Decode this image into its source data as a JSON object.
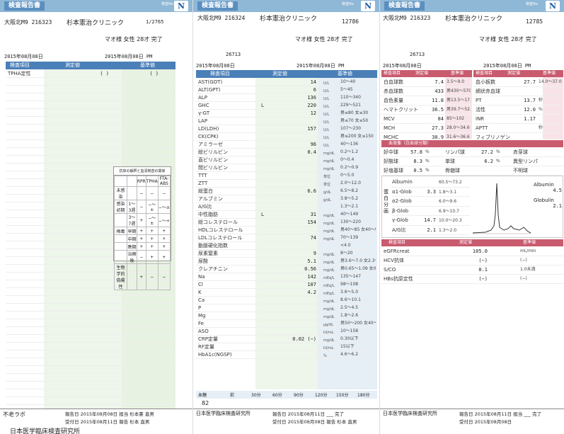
{
  "sheet1": {
    "title": "検査報告書",
    "header_small": "検査No",
    "patient_id": "大阪北M9 216323",
    "clinic": "杉本憲治クリニック",
    "page_no": "1/2765",
    "patient_line": "マオ様 女性 28才 完了",
    "received_label": "受付日",
    "received_date": "2015年08月08日",
    "reported_date": "2015年08月08日 PM",
    "col_item": "検査項目",
    "col_value": "測定値",
    "col_ref": "基準値",
    "rows": [
      {
        "name": "TPHA定性",
        "value": "( )",
        "ref": "( )"
      }
    ],
    "grid": {
      "title": "抗体の解釈と血清検査の関係",
      "head": [
        "",
        "",
        "RPR",
        "TPHA",
        "FTA-ABS"
      ],
      "rows": [
        [
          "未感染",
          "",
          "−",
          "−",
          "−"
        ],
        [
          "感染初期",
          "1〜3週",
          "−",
          "−〜±",
          "−〜±"
        ],
        [
          "",
          "3〜7週",
          "+",
          "−〜±",
          "−〜+"
        ],
        [
          "梅毒",
          "早期",
          "+",
          "+",
          "+"
        ],
        [
          "",
          "中期",
          "+",
          "+",
          "+"
        ],
        [
          "",
          "晩期",
          "+",
          "+",
          "+"
        ],
        [
          "",
          "治療後",
          "−",
          "+",
          "+"
        ],
        [
          "生物学的偽陽性",
          "",
          "+",
          "−",
          "−"
        ]
      ]
    },
    "footer_lab": "不老ラボ",
    "footer_dates": "報告日 2015年08月08日 担当 杉本憲 直男",
    "footer_dates2": "受付日 2015年08月11日 報告 杉本 直男",
    "footer_org": "日本医学臨床検査研究所"
  },
  "sheet2": {
    "title": "検査報告書",
    "header_small": "検査No",
    "patient_id": "大阪北M9 216324",
    "clinic": "杉本憲治クリニック",
    "page_no": "12786",
    "patient_line": "マオ様 女性 28才 完了",
    "doc_no": "26713",
    "received_date": "2015年08月08日",
    "reported_date": "2015年08月08日 PM",
    "col_item": "検査項目",
    "col_value": "測定値",
    "col_ref": "基準値",
    "rows": [
      {
        "name": "AST(GOT)",
        "flag": "",
        "value": "14",
        "unit": "U/L",
        "ref": "10〜40"
      },
      {
        "name": "ALT(GPT)",
        "flag": "",
        "value": "6",
        "unit": "U/L",
        "ref": "5〜45"
      },
      {
        "name": "ALP",
        "flag": "",
        "value": "136",
        "unit": "U/L",
        "ref": "110〜340"
      },
      {
        "name": "GHC",
        "flag": "L",
        "value": "220",
        "unit": "U/L",
        "ref": "229〜521"
      },
      {
        "name": "γ-GT",
        "flag": "",
        "value": "12",
        "unit": "U/L",
        "ref": "男≤80 女≤30"
      },
      {
        "name": "LAP",
        "flag": "",
        "value": "",
        "unit": "U/L",
        "ref": "男≤70 女≤50"
      },
      {
        "name": "LD(LDH)",
        "flag": "",
        "value": "157",
        "unit": "U/L",
        "ref": "107〜230"
      },
      {
        "name": "CK(CPK)",
        "flag": "",
        "value": "",
        "unit": "U/L",
        "ref": "男≤200 女≤150"
      },
      {
        "name": "アミラーゼ",
        "flag": "",
        "value": "96",
        "unit": "U/L",
        "ref": "40〜136"
      },
      {
        "name": "総ビリルビン",
        "flag": "",
        "value": "0.4",
        "unit": "mg/dL",
        "ref": "0.2〜1.2"
      },
      {
        "name": "直ビリルビン",
        "flag": "",
        "value": "",
        "unit": "mg/dL",
        "ref": "0〜0.4"
      },
      {
        "name": "間ビリルビン",
        "flag": "",
        "value": "",
        "unit": "mg/dL",
        "ref": "0.2〜0.9"
      },
      {
        "name": "TTT",
        "flag": "",
        "value": "",
        "unit": "単位",
        "ref": "0〜5.0"
      },
      {
        "name": "ZTT",
        "flag": "",
        "value": "",
        "unit": "単位",
        "ref": "2.0〜12.0"
      },
      {
        "name": "総蛋白",
        "flag": "",
        "value": "6.6",
        "unit": "g/dL",
        "ref": "6.5〜8.2"
      },
      {
        "name": "アルブミン",
        "flag": "",
        "value": "",
        "unit": "g/dL",
        "ref": "3.8〜5.2"
      },
      {
        "name": "A/G比",
        "flag": "",
        "value": "",
        "unit": "",
        "ref": "1.3〜2.1"
      },
      {
        "name": "中性脂肪",
        "flag": "L",
        "value": "31",
        "unit": "mg/dL",
        "ref": "40〜149"
      },
      {
        "name": "総コレステロール",
        "flag": "",
        "value": "154",
        "unit": "mg/dL",
        "ref": "130〜220"
      },
      {
        "name": "HDLコレステロール",
        "flag": "",
        "value": "",
        "unit": "mg/dL",
        "ref": "男40〜85 女40〜95"
      },
      {
        "name": "LDLコレステロール",
        "flag": "",
        "value": "74",
        "unit": "mg/dL",
        "ref": "70〜139"
      },
      {
        "name": "動脈硬化指数",
        "flag": "",
        "value": "",
        "unit": "",
        "ref": "<4.0"
      },
      {
        "name": "尿素窒素",
        "flag": "",
        "value": "9",
        "unit": "mg/dL",
        "ref": "8〜20"
      },
      {
        "name": "尿酸",
        "flag": "",
        "value": "5.1",
        "unit": "mg/dL",
        "ref": "男3.6〜7.0 女2.3〜7.0"
      },
      {
        "name": "クレアチニン",
        "flag": "",
        "value": "0.56",
        "unit": "mg/dL",
        "ref": "男0.65〜1.09 女0.46〜0.82"
      },
      {
        "name": "Na",
        "flag": "",
        "value": "142",
        "unit": "mEq/L",
        "ref": "135〜147"
      },
      {
        "name": "Cl",
        "flag": "",
        "value": "107",
        "unit": "mEq/L",
        "ref": "98〜108"
      },
      {
        "name": "K",
        "flag": "",
        "value": "4.2",
        "unit": "mEq/L",
        "ref": "3.6〜5.0"
      },
      {
        "name": "Ca",
        "flag": "",
        "value": "",
        "unit": "mg/dL",
        "ref": "8.6〜10.1"
      },
      {
        "name": "P",
        "flag": "",
        "value": "",
        "unit": "mg/dL",
        "ref": "2.5〜4.5"
      },
      {
        "name": "Mg",
        "flag": "",
        "value": "",
        "unit": "mg/dL",
        "ref": "1.8〜2.6"
      },
      {
        "name": "Fe",
        "flag": "",
        "value": "",
        "unit": "μg/dL",
        "ref": "男50〜200 女40〜180"
      },
      {
        "name": "ASO",
        "flag": "",
        "value": "",
        "unit": "IU/mL",
        "ref": "10〜158"
      },
      {
        "name": "CRP定量",
        "flag": "",
        "value": "0.02 (−)",
        "unit": "mg/dL",
        "ref": "0.30以下"
      },
      {
        "name": "RF定量",
        "flag": "",
        "value": "",
        "unit": "IU/mL",
        "ref": "15以下"
      },
      {
        "name": "HbA1c(NGSP)",
        "flag": "",
        "value": "",
        "unit": "%",
        "ref": "4.6〜6.2"
      }
    ],
    "glucose_label": "血糖",
    "glucose_cols": [
      "前",
      "30分",
      "60分",
      "90分",
      "120分",
      "150分",
      "180分"
    ],
    "glucose_value": "82",
    "footer_org": "日本医学臨床検査研究所",
    "footer_dates": "報告日 2015年08月11日 ___ 完了",
    "footer_dates2": "受付日 2015年08月08日 報告 杉本 直男"
  },
  "sheet3": {
    "title": "検査報告書",
    "header_small": "検査No",
    "patient_id": "大阪北M9 216323",
    "clinic": "杉本憲治クリニック",
    "page_no": "12785",
    "patient_line": "マオ様 女性 28才 完了",
    "doc_no": "26713",
    "received_date": "2015年08月08日",
    "reported_date": "2015年08月08日 PM",
    "left_head": [
      "検査項目",
      "測定値",
      "基準値"
    ],
    "right_head": [
      "検査項目",
      "測定値",
      "基準値"
    ],
    "left_rows": [
      {
        "name": "白血球数",
        "value": "7.4",
        "ref": "3.5〜9.0"
      },
      {
        "name": "赤血球数",
        "value": "433",
        "ref": "男430〜570"
      },
      {
        "name": "血色素量",
        "value": "11.8",
        "ref": "男13.5〜17.5"
      },
      {
        "name": "ヘマトクリット",
        "value": "36.5",
        "ref": "男39.7〜52.4"
      },
      {
        "name": "MCV",
        "value": "84",
        "ref": "85〜102"
      },
      {
        "name": "MCH",
        "value": "27.3",
        "ref": "28.0〜34.6"
      },
      {
        "name": "MCHC",
        "value": "30.9",
        "ref": "31.6〜36.6"
      }
    ],
    "right_rows": [
      {
        "name": "血小板数",
        "value": "27.7",
        "ref": "14.0〜37.0"
      },
      {
        "name": "網状赤血球",
        "value": "",
        "ref": ""
      },
      {
        "name": "PT",
        "value": "13.7",
        "ref": "秒"
      },
      {
        "name": "活性",
        "value": "12.0",
        "ref": "%"
      },
      {
        "name": "INR",
        "value": "1.17",
        "ref": ""
      },
      {
        "name": "APTT",
        "value": "",
        "ref": "秒"
      },
      {
        "name": "フィブリノゲン",
        "value": "",
        "ref": ""
      }
    ],
    "diff_head": "血液像（白血球分類）",
    "diff_rows": [
      {
        "l_name": "好中球",
        "l_value": "57.8",
        "l_ref": "%",
        "m_name": "リンパ球",
        "m_value": "27.2",
        "m_ref": "%",
        "r_name": "赤芽球"
      },
      {
        "l_name": "好酸球",
        "l_value": "8.3",
        "l_ref": "%",
        "m_name": "単球",
        "m_value": "6.2",
        "m_ref": "%",
        "r_name": "異型リンパ"
      },
      {
        "l_name": "好塩基球",
        "l_value": "0.5",
        "l_ref": "%",
        "m_name": "骨髄球",
        "m_value": "",
        "m_ref": "",
        "r_name": "不明球"
      }
    ],
    "electro_label": "蛋白分画",
    "electro_rows": [
      {
        "name": "Albumin",
        "value": "",
        "ref": "60.5〜73.2"
      },
      {
        "name": "α1-Glob",
        "value": "3.3",
        "ref": "1.8〜3.1"
      },
      {
        "name": "α2-Glob",
        "value": "",
        "ref": "6.0〜9.6"
      },
      {
        "name": "β-Glob",
        "value": "",
        "ref": "6.9〜10.7"
      },
      {
        "name": "γ-Glob",
        "value": "14.7",
        "ref": "10.0〜20.3"
      },
      {
        "name": "A/G比",
        "value": "2.1",
        "ref": "1.3〜2.0"
      }
    ],
    "electro_right": [
      {
        "name": "Albumin",
        "value": "4.5"
      },
      {
        "name": "Globulin",
        "value": "2.1"
      }
    ],
    "panel_head": [
      "検査項目",
      "測定値",
      "基準値"
    ],
    "panel_rows": [
      {
        "name": "eGFRcreat",
        "value": "105.0",
        "ref": "mL/min"
      },
      {
        "name": "HCV抗体",
        "value": "(−)",
        "ref": "(−)"
      },
      {
        "name": "S/CO",
        "value": "0.1",
        "ref": "1.0未満"
      },
      {
        "name": "HBs抗原定性",
        "value": "(−)",
        "ref": "(−)"
      }
    ],
    "footer_org": "日本医学臨床検査研究所",
    "footer_dates": "報告日 2015年08月11日 担当 ___ 完了",
    "footer_dates2": "受付日 2015年08月08日"
  }
}
